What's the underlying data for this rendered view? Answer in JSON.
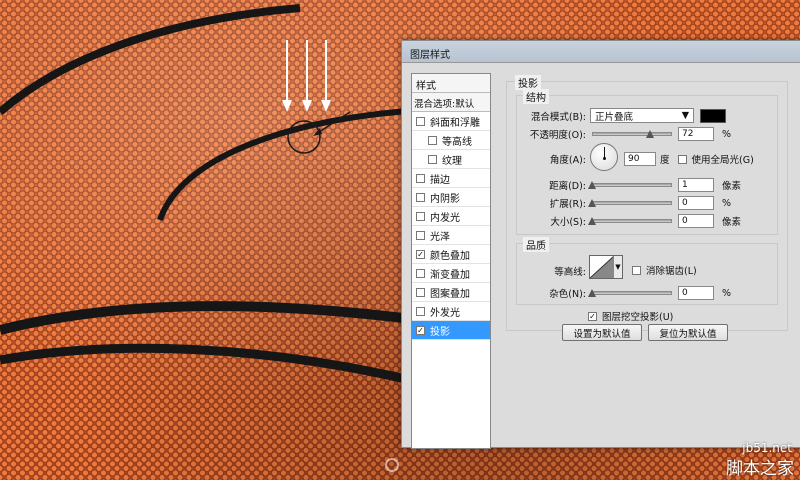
{
  "dialog": {
    "title": "图层样式",
    "styles_header": "样式",
    "blend_options": "混合选项:默认",
    "styles": [
      {
        "label": "斜面和浮雕",
        "checked": false,
        "sub": false
      },
      {
        "label": "等高线",
        "checked": false,
        "sub": true
      },
      {
        "label": "纹理",
        "checked": false,
        "sub": true
      },
      {
        "label": "描边",
        "checked": false,
        "sub": false
      },
      {
        "label": "内阴影",
        "checked": false,
        "sub": false
      },
      {
        "label": "内发光",
        "checked": false,
        "sub": false
      },
      {
        "label": "光泽",
        "checked": false,
        "sub": false
      },
      {
        "label": "颜色叠加",
        "checked": true,
        "sub": false
      },
      {
        "label": "渐变叠加",
        "checked": false,
        "sub": false
      },
      {
        "label": "图案叠加",
        "checked": false,
        "sub": false
      },
      {
        "label": "外发光",
        "checked": false,
        "sub": false
      },
      {
        "label": "投影",
        "checked": true,
        "sub": false,
        "selected": true
      }
    ]
  },
  "drop_shadow": {
    "section_title": "投影",
    "structure": {
      "title": "结构",
      "blend_mode_label": "混合模式(B):",
      "blend_mode_value": "正片叠底",
      "color": "#000000",
      "opacity_label": "不透明度(O):",
      "opacity_value": "72",
      "opacity_unit": "%",
      "angle_label": "角度(A):",
      "angle_value": "90",
      "angle_unit": "度",
      "global_light_label": "使用全局光(G)",
      "global_light_checked": false,
      "distance_label": "距离(D):",
      "distance_value": "1",
      "distance_unit": "像素",
      "spread_label": "扩展(R):",
      "spread_value": "0",
      "spread_unit": "%",
      "size_label": "大小(S):",
      "size_value": "0",
      "size_unit": "像素"
    },
    "quality": {
      "title": "品质",
      "contour_label": "等高线:",
      "antialias_label": "消除锯齿(L)",
      "antialias_checked": false,
      "noise_label": "杂色(N):",
      "noise_value": "0",
      "noise_unit": "%"
    },
    "knockout_label": "图层挖空投影(U)",
    "knockout_checked": true,
    "set_default_button": "设置为默认值",
    "reset_default_button": "复位为默认值"
  },
  "watermark": {
    "site": "jb51.net",
    "name": "脚本之家"
  },
  "colors": {
    "selected": "#3399ff",
    "ball": "#b5502a"
  }
}
